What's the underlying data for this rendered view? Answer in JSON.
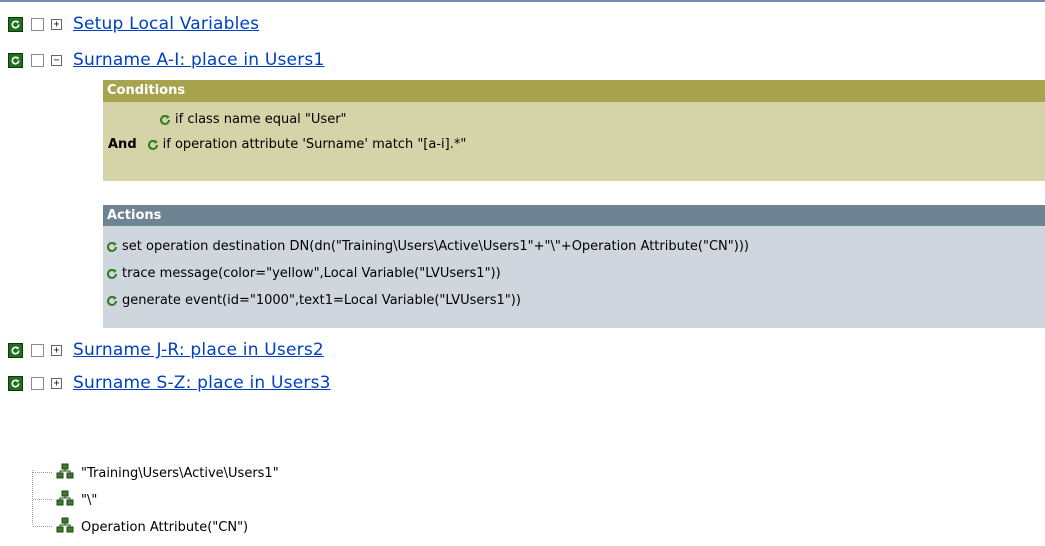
{
  "rules": [
    {
      "label": "Setup Local Variables",
      "expander": "+"
    },
    {
      "label": "Surname A-I: place in Users1",
      "expander": "−"
    },
    {
      "label": "Surname J-R: place in Users2",
      "expander": "+"
    },
    {
      "label": "Surname S-Z: place in Users3",
      "expander": "+"
    }
  ],
  "conditions": {
    "header": "Conditions",
    "items": [
      {
        "prefix": "",
        "text": "if class name equal \"User\""
      },
      {
        "prefix": "And",
        "text": "if operation attribute 'Surname' match \"[a-i].*\""
      }
    ]
  },
  "actions": {
    "header": "Actions",
    "items": [
      "set operation destination DN(dn(\"Training\\Users\\Active\\Users1\"+\"\\\"+Operation Attribute(\"CN\")))",
      "trace message(color=\"yellow\",Local Variable(\"LVUsers1\"))",
      "generate event(id=\"1000\",text1=Local Variable(\"LVUsers1\"))"
    ]
  },
  "tree": [
    "\"Training\\Users\\Active\\Users1\"",
    "\"\\\"",
    "Operation Attribute(\"CN\")"
  ],
  "icons": {
    "enabled": "enabled-refresh-icon",
    "statement": "statement-refresh-icon",
    "token": "token-tree-icon"
  },
  "colors": {
    "link": "#0040c0",
    "conditions_header": "#a8a44e",
    "conditions_body": "#d5d3a8",
    "actions_header": "#6e8493",
    "actions_body": "#cfd6dd",
    "enabled_icon": "#1f6f1f",
    "token_icon": "#3a7a2a"
  }
}
